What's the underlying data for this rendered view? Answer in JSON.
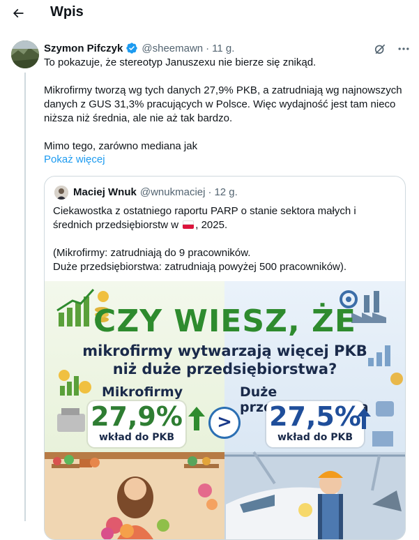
{
  "header": {
    "title": "Wpis",
    "back_icon": "arrow-left-icon"
  },
  "post": {
    "author_name": "Szymon Pifczyk",
    "handle": "@sheemawn",
    "separator": "·",
    "time": "11 g.",
    "verified_icon": "verified-badge-icon",
    "body": "To pokazuje, że stereotyp Januszexu nie bierze się znikąd.\n\nMikrofirmy tworzą wg tych danych 27,9% PKB, a zatrudniają wg najnowszych danych z GUS 31,3% pracujących w Polsce. Więc wydajność jest tam nieco niższa niż średnia, ale nie aż tak bardzo.\n\nMimo tego, zarówno mediana jak",
    "show_more": "Pokaż więcej",
    "icons": [
      "grok-icon",
      "more-icon"
    ]
  },
  "quote": {
    "author_name": "Maciej Wnuk",
    "handle": "@wnukmaciej",
    "separator": "·",
    "time": "12 g.",
    "text_before_flag": "Ciekawostka z ostatniego raportu PARP o stanie sektora małych i średnich przedsiębiorstw w ",
    "text_after_flag": ", 2025.\n\n(Mikrofirmy: zatrudniają do 9 pracowników.\nDuże przedsiębiorstwa: zatrudniają powyżej 500 pracowników).",
    "flag_icon": "poland-flag-icon"
  },
  "infographic": {
    "headline": "CZY WIESZ, ŻE",
    "subheadline": "mikrofirmy wytwarzają więcej PKB\nniż duże przedsiębiorstwa?",
    "left_title": "Mikrofirmy",
    "left_value": "27,9%",
    "left_label": "wkład do PKB",
    "right_title": "Duże przedsiębiorstwa",
    "right_value": "27,5%",
    "right_label": "wkład do PKB",
    "compare_symbol": ">",
    "colors": {
      "headline": "#2e8b2e",
      "left_value": "#2e7d32",
      "right_value": "#1f4e9a",
      "left_bg": "#eef7e6",
      "right_bg": "#e5eff8"
    }
  }
}
